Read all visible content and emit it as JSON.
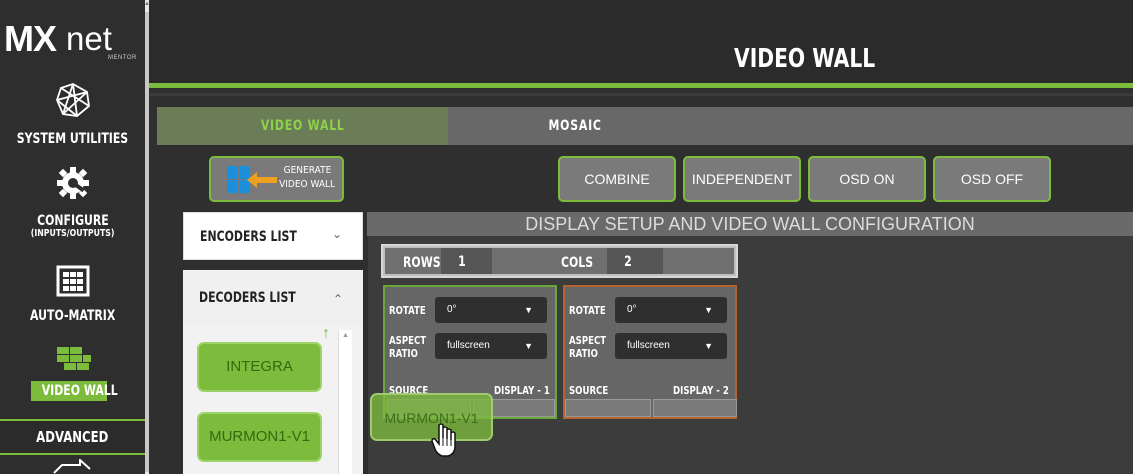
{
  "app": {
    "logo_main": "MX",
    "logo_suffix": "net",
    "logo_tag": "MENTOR"
  },
  "sidebar": {
    "items": [
      {
        "label": "SYSTEM UTILITIES",
        "icon": "network-globe-icon"
      },
      {
        "label": "CONFIGURE",
        "sub": "(INPUTS/OUTPUTS)",
        "icon": "gear-wrench-icon"
      },
      {
        "label": "AUTO-MATRIX",
        "icon": "matrix-grid-icon"
      },
      {
        "label": "VIDEO WALL",
        "icon": "video-wall-icon",
        "active": true
      },
      {
        "label": "ADVANCED",
        "icon": "arrows-icon"
      }
    ]
  },
  "header": {
    "title": "VIDEO WALL"
  },
  "tabs": [
    {
      "label": "VIDEO WALL",
      "active": true
    },
    {
      "label": "MOSAIC"
    }
  ],
  "toolbar": {
    "generate_line1": "GENERATE",
    "generate_line2": "VIDEO WALL",
    "combine": "COMBINE",
    "independent": "INDEPENDENT",
    "osd_on": "OSD ON",
    "osd_off": "OSD OFF"
  },
  "lists": {
    "encoders": {
      "label": "ENCODERS LIST",
      "chevron": "⌄"
    },
    "decoders": {
      "label": "DECODERS LIST",
      "chevron": "⌃",
      "items": [
        "INTEGRA",
        "MURMON1-V1"
      ]
    }
  },
  "setup": {
    "title": "DISPLAY SETUP AND VIDEO WALL CONFIGURATION",
    "rows_label": "ROWS",
    "rows_value": "1",
    "cols_label": "COLS",
    "cols_value": "2",
    "displays": [
      {
        "rotate_label": "ROTATE",
        "rotate_value": "0°",
        "aspect_label_1": "ASPECT",
        "aspect_label_2": "RATIO",
        "aspect_value": "fullscreen",
        "source_label": "SOURCE",
        "name": "DISPLAY - 1"
      },
      {
        "rotate_label": "ROTATE",
        "rotate_value": "0°",
        "aspect_label_1": "ASPECT",
        "aspect_label_2": "RATIO",
        "aspect_value": "fullscreen",
        "source_label": "SOURCE",
        "name": "DISPLAY - 2"
      }
    ]
  },
  "drag": {
    "label": "MURMON1-V1"
  },
  "colors": {
    "accent": "#7dbb3c",
    "display1_border": "#6aa63a",
    "display2_border": "#b5632f"
  }
}
